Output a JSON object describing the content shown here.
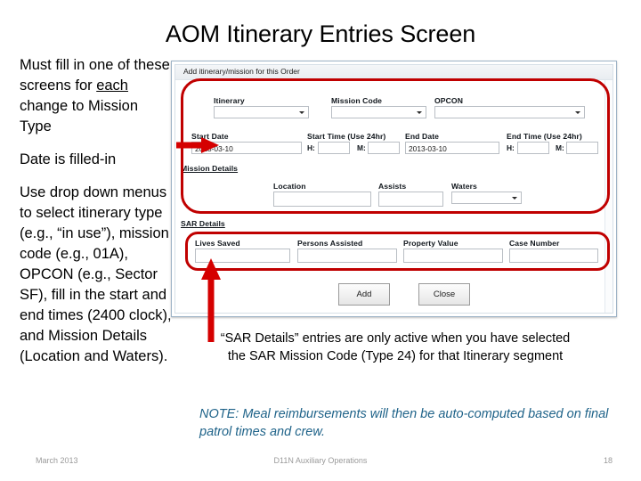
{
  "slide": {
    "title": "AOM Itinerary Entries Screen",
    "accent_red": "#c00000",
    "note_color": "#1f6389"
  },
  "left_notes": {
    "p1_a": "Must fill in one of these screens for ",
    "p1_underline": "each",
    "p1_b": " change to Mission Type",
    "p2": "Date is filled-in",
    "p3": "Use drop down menus to select itinerary type (e.g., “in use”), mission code (e.g., 01A), OPCON (e.g., Sector SF), fill in the start and end times (2400 clock), and Mission Details (Location and Waters)."
  },
  "window": {
    "titlebar": "Add itinerary/mission for this Order",
    "row1": {
      "itinerary_label": "Itinerary",
      "itinerary_value": "",
      "mission_code_label": "Mission Code",
      "mission_code_value": "",
      "opcon_label": "OPCON",
      "opcon_value": ""
    },
    "row2": {
      "start_date_label": "Start Date",
      "start_date_value": "2013-03-10",
      "start_time_label": "Start Time  (Use 24hr)",
      "start_h_prefix": "H:",
      "start_h_value": "",
      "start_m_prefix": "M:",
      "start_m_value": "",
      "end_date_label": "End Date",
      "end_date_value": "2013-03-10",
      "end_time_label": "End Time  (Use 24hr)",
      "end_h_prefix": "H:",
      "end_h_value": "",
      "end_m_prefix": "M:",
      "end_m_value": ""
    },
    "mission_details": {
      "section_label": "Mission Details",
      "location_label": "Location",
      "location_value": "",
      "assists_label": "Assists",
      "assists_value": "",
      "waters_label": "Waters",
      "waters_value": ""
    },
    "sar_details": {
      "section_label": "SAR Details",
      "lives_saved_label": "Lives Saved",
      "lives_saved_value": "",
      "persons_assisted_label": "Persons Assisted",
      "persons_assisted_value": "",
      "property_value_label": "Property Value",
      "property_value_value": "",
      "case_number_label": "Case Number",
      "case_number_value": ""
    },
    "buttons": {
      "add": "Add",
      "close": "Close"
    }
  },
  "bottom_notes": {
    "sar_note": "“SAR Details” entries are only active when you have selected the SAR Mission Code (Type 24) for that Itinerary segment",
    "meal_note": "NOTE:   Meal reimbursements will then be auto-computed based on final patrol times and crew."
  },
  "footer": {
    "left": "March 2013",
    "center": "D11N Auxiliary Operations",
    "right": "18"
  }
}
